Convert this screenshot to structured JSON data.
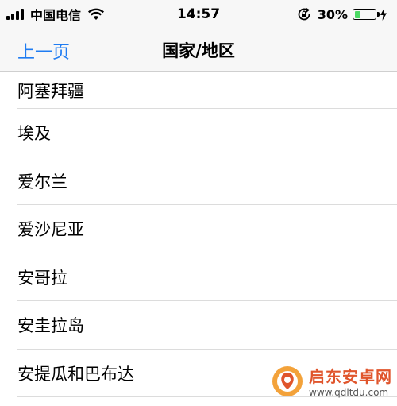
{
  "status_bar": {
    "carrier": "中国电信",
    "time": "14:57",
    "battery_percent": "30%",
    "battery_level": 0.3,
    "battery_color": "#4cd964",
    "icons": [
      "signal-icon",
      "wifi-icon",
      "rotation-lock-icon",
      "battery-icon",
      "charging-bolt-icon"
    ]
  },
  "nav": {
    "back_label": "上一页",
    "title": "国家/地区",
    "accent_color": "#1f7cf2"
  },
  "list": {
    "items": [
      "阿塞拜疆",
      "埃及",
      "爱尔兰",
      "爱沙尼亚",
      "安哥拉",
      "安圭拉岛",
      "安提瓜和巴布达"
    ]
  },
  "watermark": {
    "name": "启东安卓网",
    "url": "www.qdltdu.com"
  }
}
